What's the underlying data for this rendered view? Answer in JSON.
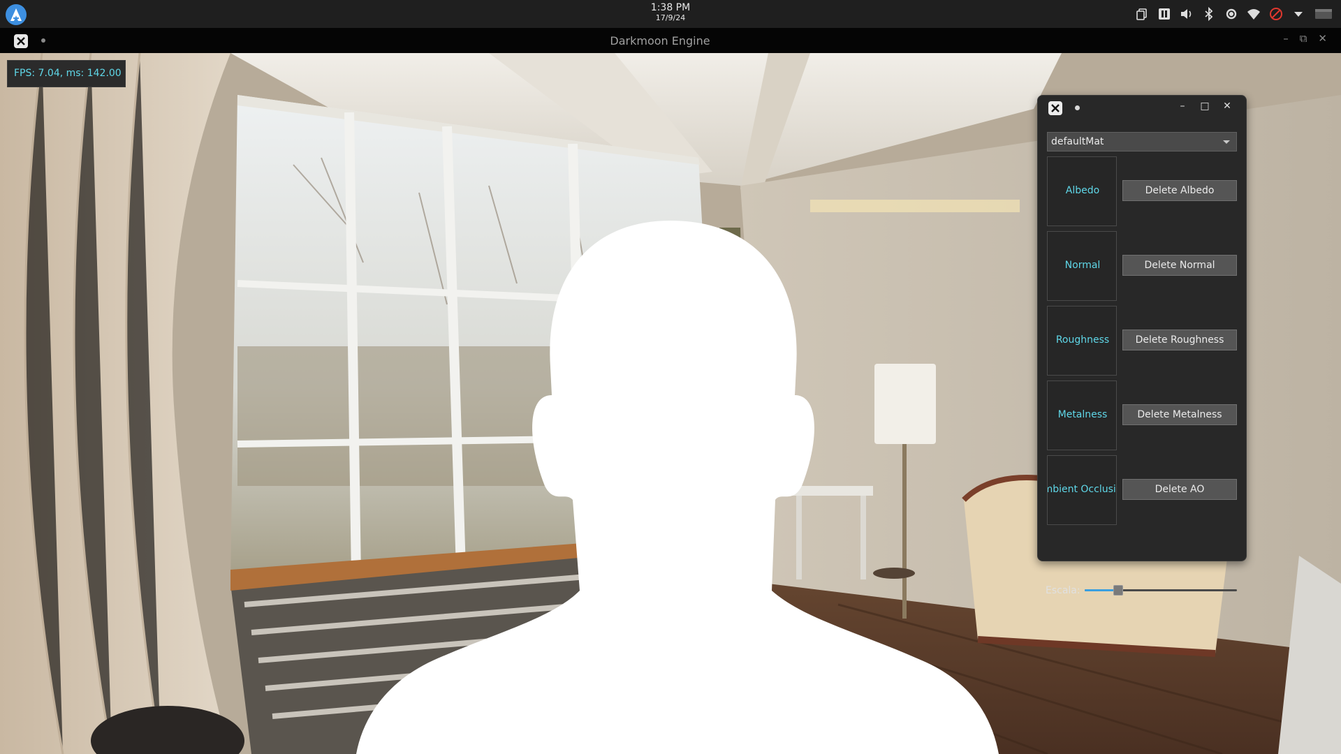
{
  "system_bar": {
    "time": "1:38 PM",
    "date": "17/9/24",
    "tray_icons": [
      "clipboard-icon",
      "pause-icon",
      "volume-icon",
      "bluetooth-icon",
      "brightness-icon",
      "wifi-icon",
      "do-not-disturb-icon",
      "menu-chevron-icon",
      "window-switcher-icon"
    ]
  },
  "app_window": {
    "title": "Darkmoon Engine"
  },
  "overlay": {
    "fps_text": "FPS: 7.04, ms: 142.00"
  },
  "material_panel": {
    "selected_material": "defaultMat",
    "slots": [
      {
        "label": "Albedo",
        "button": "Delete Albedo"
      },
      {
        "label": "Normal",
        "button": "Delete Normal"
      },
      {
        "label": "Roughness",
        "button": "Delete Roughness"
      },
      {
        "label": "Metalness",
        "button": "Delete Metalness"
      },
      {
        "label": "Ambient Occlusion",
        "button": "Delete AO"
      }
    ],
    "scale_label": "Escala:",
    "scale_fraction": 0.22
  },
  "colors": {
    "accent_text": "#5fd7e8",
    "slider_fill": "#3a9fe0",
    "dnd_red": "#e0382e"
  }
}
